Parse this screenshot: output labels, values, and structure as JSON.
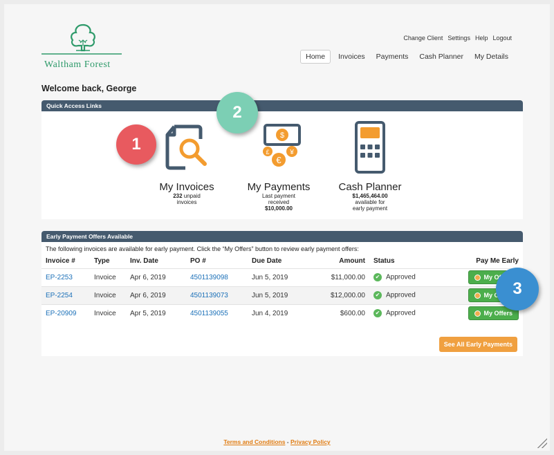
{
  "brand": {
    "name": "Waltham Forest"
  },
  "top_links": [
    "Change Client",
    "Settings",
    "Help",
    "Logout"
  ],
  "nav": [
    {
      "label": "Home",
      "active": true
    },
    {
      "label": "Invoices",
      "active": false
    },
    {
      "label": "Payments",
      "active": false
    },
    {
      "label": "Cash Planner",
      "active": false
    },
    {
      "label": "My Details",
      "active": false
    }
  ],
  "welcome": "Welcome back, George",
  "quick_access": {
    "header": "Quick Access Links",
    "invoices": {
      "title": "My Invoices",
      "count": "232",
      "line1": "unpaid",
      "line2": "invoices"
    },
    "payments": {
      "title": "My Payments",
      "line1": "Last payment",
      "line2": "received",
      "amount": "$10,000.00"
    },
    "planner": {
      "title": "Cash Planner",
      "amount": "$1,465,464.00",
      "line1": "available for",
      "line2": "early payment"
    }
  },
  "badges": {
    "one": "1",
    "two": "2",
    "three": "3"
  },
  "early_payments": {
    "header": "Early Payment Offers Available",
    "intro": "The following invoices are available for early payment. Click the “My Offers” button to review early payment offers:",
    "columns": [
      "Invoice #",
      "Type",
      "Inv. Date",
      "PO #",
      "Due Date",
      "Amount",
      "Status",
      "Pay Me Early"
    ],
    "rows": [
      {
        "invoice": "EP-2253",
        "type": "Invoice",
        "inv_date": "Apr 6, 2019",
        "po": "4501139098",
        "due_date": "Jun 5, 2019",
        "amount": "$11,000.00",
        "status": "Approved",
        "action": "My Offers"
      },
      {
        "invoice": "EP-2254",
        "type": "Invoice",
        "inv_date": "Apr 6, 2019",
        "po": "4501139073",
        "due_date": "Jun 5, 2019",
        "amount": "$12,000.00",
        "status": "Approved",
        "action": "My Offers"
      },
      {
        "invoice": "EP-20909",
        "type": "Invoice",
        "inv_date": "Apr 5, 2019",
        "po": "4501139055",
        "due_date": "Jun 4, 2019",
        "amount": "$600.00",
        "status": "Approved",
        "action": "My Offers"
      }
    ],
    "see_all": "See All Early Payments"
  },
  "footer": {
    "terms": "Terms and Conditions",
    "sep": " - ",
    "privacy": "Privacy Policy"
  },
  "colors": {
    "header": "#455a6e",
    "link": "#1b70b8",
    "green": "#4cae4c",
    "orange": "#f0a040",
    "badge1": "#e85a5f",
    "badge2": "#7ccfb4",
    "badge3": "#3a8fd1"
  }
}
